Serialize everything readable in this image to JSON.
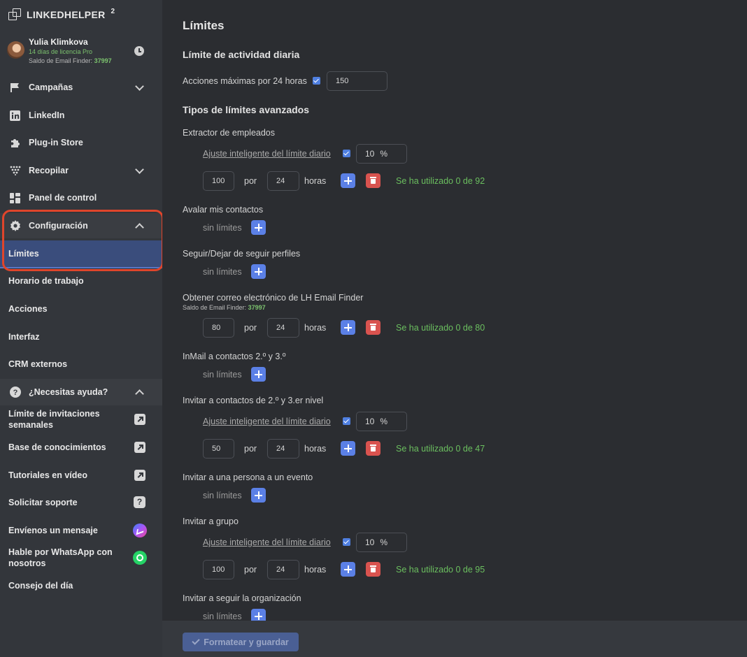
{
  "app": {
    "logo_text": "LINKEDHELPER",
    "logo_version": "2"
  },
  "user": {
    "name": "Yulia Klimkova",
    "license": "14 días de licencia Pro",
    "saldo_label": "Saldo de Email Finder:",
    "saldo_value": "37997"
  },
  "sidebar": {
    "campanas": "Campañas",
    "linkedin": "LinkedIn",
    "plugin_store": "Plug-in Store",
    "recopilar": "Recopilar",
    "panel": "Panel de control",
    "configuracion": "Configuración",
    "limites": "Límites",
    "horario": "Horario de trabajo",
    "acciones": "Acciones",
    "interfaz": "Interfaz",
    "crm": "CRM externos",
    "ayuda": "¿Necesitas ayuda?",
    "limite_inv": "Límite de invitaciones semanales",
    "base": "Base de conocimientos",
    "tutoriales": "Tutoriales en vídeo",
    "soporte": "Solicitar soporte",
    "mensaje": "Envíenos un mensaje",
    "whatsapp": "Hable por WhatsApp con nosotros",
    "consejo": "Consejo del día"
  },
  "main": {
    "title": "Límites",
    "daily_heading": "Límite de actividad diaria",
    "daily_label": "Acciones máximas por 24 horas",
    "daily_value": "150",
    "advanced_heading": "Tipos de límites avanzados",
    "smart_label": "Ajuste inteligente del límite diario",
    "unlimited": "sin límites",
    "per": "por",
    "hours": "horas",
    "pct_sign": "%",
    "email_saldo_label": "Saldo de Email Finder:",
    "email_saldo_value": "37997",
    "sections": {
      "extractor": {
        "label": "Extractor de empleados",
        "pct": "10",
        "count": "100",
        "hours": "24",
        "used": "Se ha utilizado 0 de 92"
      },
      "avalar": {
        "label": "Avalar mis contactos"
      },
      "seguir": {
        "label": "Seguir/Dejar de seguir perfiles"
      },
      "email": {
        "label": "Obtener correo electrónico de LH Email Finder",
        "count": "80",
        "hours": "24",
        "used": "Se ha utilizado 0 de 80"
      },
      "inmail": {
        "label": "InMail a contactos 2.º y 3.º"
      },
      "invitar_contactos": {
        "label": "Invitar a contactos de 2.º y 3.er nivel",
        "pct": "10",
        "count": "50",
        "hours": "24",
        "used": "Se ha utilizado 0 de 47"
      },
      "evento": {
        "label": "Invitar a una persona a un evento"
      },
      "grupo": {
        "label": "Invitar a grupo",
        "pct": "10",
        "count": "100",
        "hours": "24",
        "used": "Se ha utilizado 0 de 95"
      },
      "organizacion": {
        "label": "Invitar a seguir la organización"
      }
    }
  },
  "footer": {
    "save_label": "Formatear y guardar"
  }
}
